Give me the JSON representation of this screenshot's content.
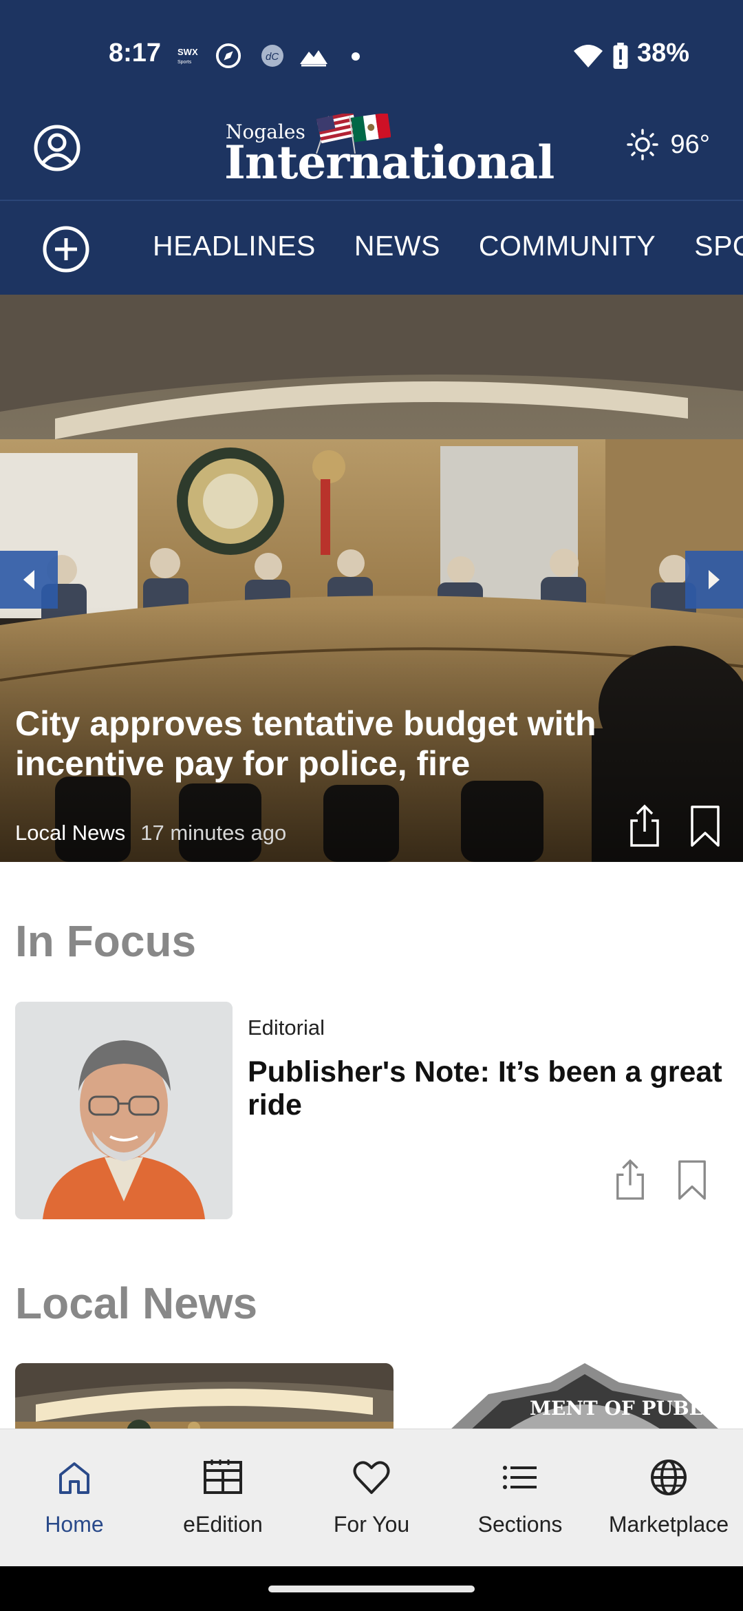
{
  "status_bar": {
    "time": "8:17",
    "battery_percent": "38%",
    "notification_icons": [
      "swx-sports-icon",
      "compass-app-icon",
      "dc-app-icon",
      "mountain-app-icon",
      "dot-icon"
    ]
  },
  "header": {
    "logo_small": "Nogales",
    "logo_big": "International",
    "weather_temp": "96°",
    "weather_icon": "sun-icon"
  },
  "nav": {
    "tabs": [
      "HEADLINES",
      "NEWS",
      "COMMUNITY",
      "SPO"
    ]
  },
  "hero": {
    "title": "City approves tentative budget with incentive pay for police, fire",
    "category": "Local News",
    "time": "17 minutes ago"
  },
  "in_focus": {
    "section_title": "In Focus",
    "category": "Editorial",
    "title": "Publisher's Note: It’s been a great ride"
  },
  "local_news": {
    "section_title": "Local News"
  },
  "bottom_nav": {
    "items": [
      {
        "label": "Home",
        "icon": "home-icon",
        "active": true
      },
      {
        "label": "eEdition",
        "icon": "newspaper-icon",
        "active": false
      },
      {
        "label": "For You",
        "icon": "heart-icon",
        "active": false
      },
      {
        "label": "Sections",
        "icon": "list-icon",
        "active": false
      },
      {
        "label": "Marketplace",
        "icon": "globe-icon",
        "active": false
      }
    ]
  },
  "colors": {
    "brand_navy": "#1d3461",
    "active_nav": "#2a4a8a",
    "section_gray": "#888888"
  }
}
